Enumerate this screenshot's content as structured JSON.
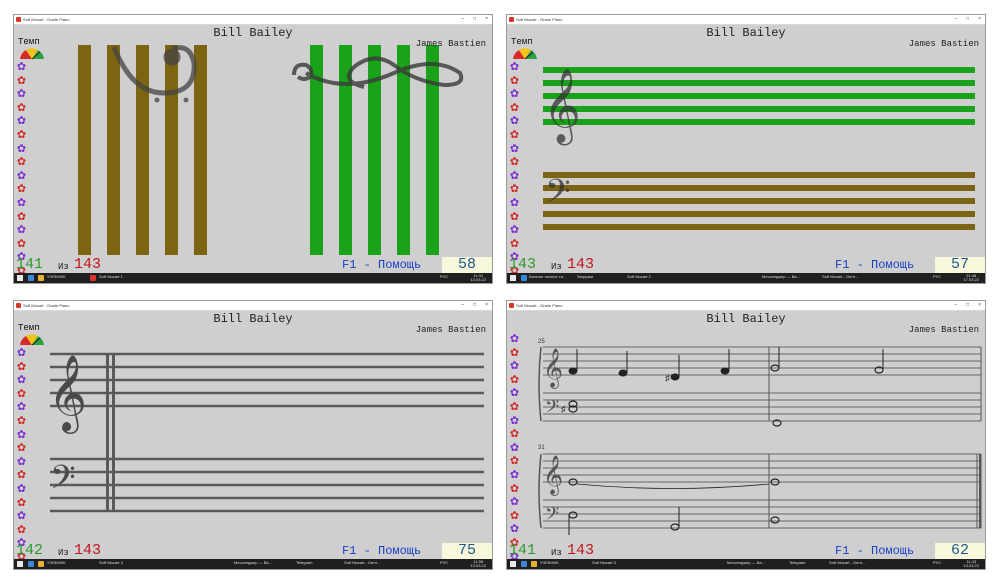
{
  "window_title": "Soft Mozart - Grade Piano",
  "song_title": "Bill Bailey",
  "composer": "James Bastien",
  "tempo_label": "Темп",
  "of_label": "Из",
  "help_label": "F1 - Помощь",
  "window_controls": [
    "–",
    "□",
    "×"
  ],
  "flower_colors": [
    "#7a2fd0",
    "#d02a2a",
    "#7a2fd0",
    "#d02a2a",
    "#7a2fd0",
    "#d02a2a",
    "#7a2fd0",
    "#d02a2a",
    "#7a2fd0",
    "#d02a2a",
    "#7a2fd0",
    "#d02a2a",
    "#7a2fd0",
    "#d02a2a",
    "#7a2fd0",
    "#d02a2a"
  ],
  "panels": [
    {
      "id": "p1",
      "current": "141",
      "total": "143",
      "score": "58",
      "view": "staff-bars",
      "taskbar_items": [
        "УЧЕБНИК",
        "Soft Mozart 1"
      ],
      "clock_time": "11:41",
      "clock_date": "13.03.22",
      "lang": "РУС"
    },
    {
      "id": "p2",
      "current": "143",
      "total": "143",
      "score": "57",
      "view": "colored-staff",
      "taskbar_items": [
        "Каталог ночное та...",
        "Загрузки",
        "Soft Mozart 2",
        "Мессенджер — Ва...",
        "Soft Mozart - Gent..."
      ],
      "clock_time": "21:48",
      "clock_date": "17.03.22",
      "lang": "РУС"
    },
    {
      "id": "p3",
      "current": "142",
      "total": "143",
      "score": "75",
      "view": "grand-staff",
      "taskbar_items": [
        "УЧЕБНИК",
        "Soft Mozart 3",
        "Мессенджер — Ва...",
        "Telegram",
        "Soft Mozart - Gent..."
      ],
      "clock_time": "11:58",
      "clock_date": "13.03.22",
      "lang": "РУС"
    },
    {
      "id": "p4",
      "current": "141",
      "total": "143",
      "score": "62",
      "view": "notation",
      "measure_numbers": [
        "25",
        "31"
      ],
      "taskbar_items": [
        "УЧЕБНИК",
        "Soft Mozart 3",
        "Мессенджер — Ва...",
        "Telegram",
        "Soft Mozart - Gent..."
      ],
      "clock_time": "11:43",
      "clock_date": "13.03.22",
      "lang": "РУС"
    }
  ],
  "colors": {
    "brown_bar": "#7d6412",
    "green_bar": "#1aa31a",
    "staff_line": "#5a5a5a",
    "counter_green": "#2e9a2e",
    "counter_red": "#c0141e",
    "help_blue": "#1a3fc8"
  }
}
